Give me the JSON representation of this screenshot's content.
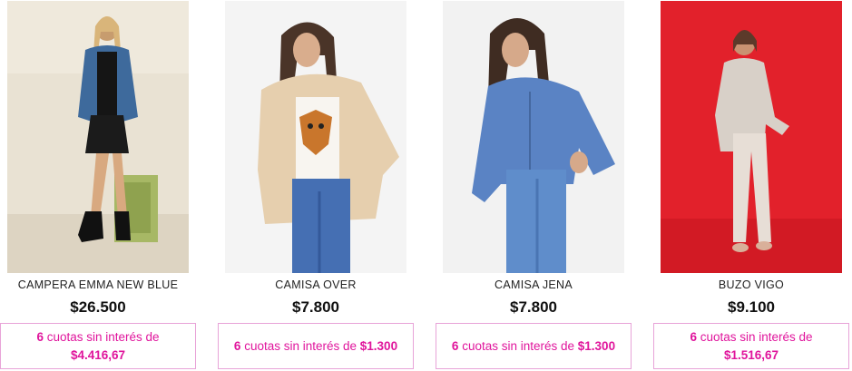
{
  "products": [
    {
      "name": "CAMPERA EMMA NEW BLUE",
      "price": "$26.500",
      "installments_count": "6",
      "installments_text": "cuotas sin interés de",
      "installment_amount": "$4.416,67",
      "image_icon": "product-photo"
    },
    {
      "name": "CAMISA OVER",
      "price": "$7.800",
      "installments_count": "6",
      "installments_text": "cuotas sin interés de",
      "installment_amount": "$1.300",
      "image_icon": "product-photo"
    },
    {
      "name": "CAMISA JENA",
      "price": "$7.800",
      "installments_count": "6",
      "installments_text": "cuotas sin interés de",
      "installment_amount": "$1.300",
      "image_icon": "product-photo"
    },
    {
      "name": "BUZO VIGO",
      "price": "$9.100",
      "installments_count": "6",
      "installments_text": "cuotas sin interés de",
      "installment_amount": "$1.516,67",
      "image_icon": "product-photo"
    }
  ],
  "colors": {
    "accent": "#e0159c",
    "border": "#e8a3d8"
  }
}
